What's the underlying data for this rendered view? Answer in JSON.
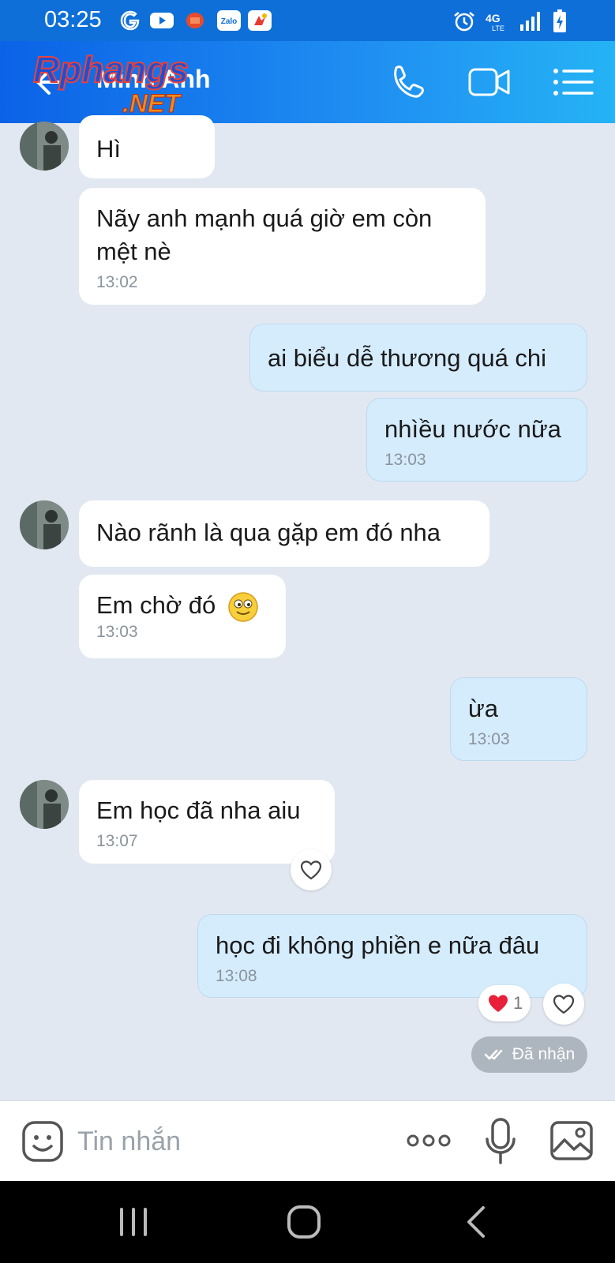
{
  "status_bar": {
    "time": "03:25",
    "network": "4G",
    "network_sub": "LTE",
    "icons": [
      "google-icon",
      "youtube-icon",
      "red-app-icon",
      "zalo-icon",
      "app-icon",
      "alarm-icon",
      "signal-icon",
      "battery-charging-icon"
    ],
    "zalo_label": "Zalo"
  },
  "header": {
    "contact_name": "Minh Anh",
    "watermark_text": "Rphangs",
    "watermark_net": ".NET",
    "icons": [
      "back-arrow-icon",
      "phone-icon",
      "video-call-icon",
      "menu-icon"
    ]
  },
  "messages": [
    {
      "side": "in",
      "text": "Hì"
    },
    {
      "side": "in",
      "text": "Nãy anh mạnh quá giờ em còn mệt nè",
      "time": "13:02"
    },
    {
      "side": "out",
      "text": "ai biểu dễ thương quá chi"
    },
    {
      "side": "out",
      "text": "nhìều nước nữa",
      "time": "13:03"
    },
    {
      "side": "in",
      "text": "Nào rãnh là qua gặp em đó nha"
    },
    {
      "side": "in",
      "text": "Em chờ đó",
      "time": "13:03",
      "emoji": "smiley-emoji"
    },
    {
      "side": "out",
      "text": "ừa",
      "time": "13:03"
    },
    {
      "side": "in",
      "text": "Em học đã nha aiu",
      "time": "13:07"
    },
    {
      "side": "out",
      "text": "học đi không phiền e nữa đâu",
      "time": "13:08",
      "reaction_count": "1"
    }
  ],
  "received_status": "Đã nhận",
  "input": {
    "placeholder": "Tin nhắn"
  },
  "colors": {
    "header_start": "#0b62e6",
    "header_end": "#25b3f5",
    "chat_bg": "#e2e8f1",
    "outgoing_bubble": "#d5ecfd",
    "incoming_bubble": "#ffffff"
  }
}
